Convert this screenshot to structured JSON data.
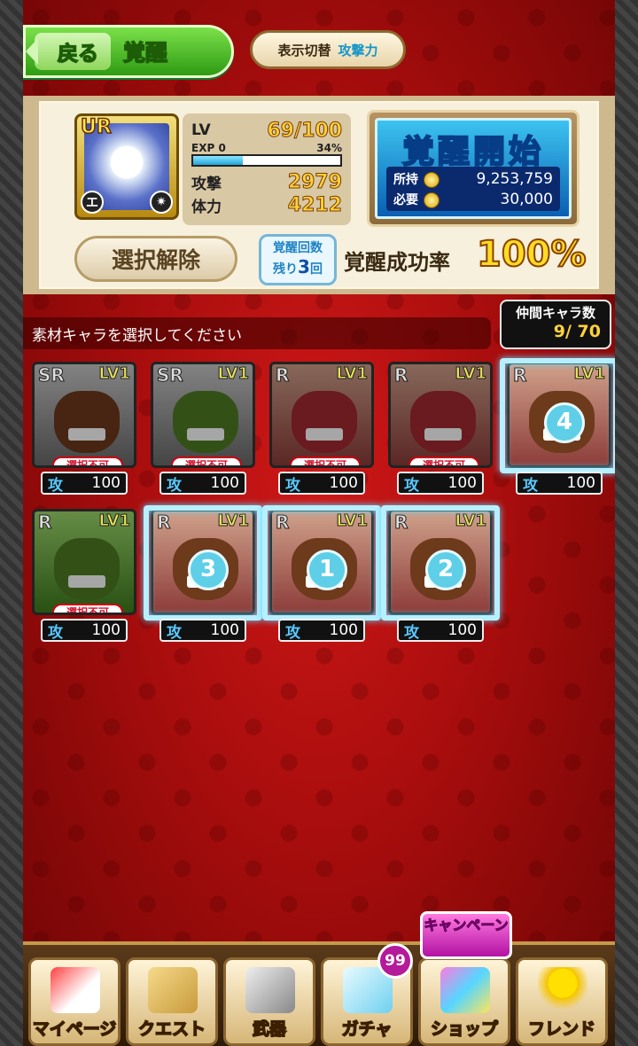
{
  "header": {
    "back_label": "戻る",
    "title": "覚醒",
    "toggle_label": "表示切替",
    "toggle_value": "攻撃力"
  },
  "character": {
    "rarity": "UR",
    "attr_left": "エ",
    "attr_right": "✷",
    "lv_label": "LV",
    "lv_value": "69/100",
    "exp_label": "EXP",
    "exp_value": "0",
    "exp_percent": "34%",
    "atk_label": "攻撃",
    "atk_value": "2979",
    "hp_label": "体力",
    "hp_value": "4212"
  },
  "awaken": {
    "title": "覚醒開始",
    "owned_label": "所持",
    "owned_value": "9,253,759",
    "required_label": "必要",
    "required_value": "30,000"
  },
  "release_label": "選択解除",
  "count": {
    "line1": "覚醒回数",
    "prefix": "残り",
    "value": "3",
    "suffix": "回"
  },
  "rate": {
    "label": "覚醒成功率",
    "value": "100%"
  },
  "notice": "素材キャラを選択してください",
  "party": {
    "label": "仲間キャラ数",
    "value": "9/ 70"
  },
  "cards": [
    {
      "rarity": "SR",
      "lv": "LV1",
      "ng": "選択不可",
      "atk_label": "攻",
      "atk": "100"
    },
    {
      "rarity": "SR",
      "lv": "LV1",
      "ng": "選択不可",
      "atk_label": "攻",
      "atk": "100"
    },
    {
      "rarity": "R",
      "lv": "LV1",
      "ng": "選択不可",
      "atk_label": "攻",
      "atk": "100"
    },
    {
      "rarity": "R",
      "lv": "LV1",
      "ng": "選択不可",
      "atk_label": "攻",
      "atk": "100"
    },
    {
      "rarity": "R",
      "lv": "LV1",
      "select": "4",
      "atk_label": "攻",
      "atk": "100"
    },
    {
      "rarity": "R",
      "lv": "LV1",
      "ng": "選択不可",
      "atk_label": "攻",
      "atk": "100"
    },
    {
      "rarity": "R",
      "lv": "LV1",
      "select": "3",
      "atk_label": "攻",
      "atk": "100"
    },
    {
      "rarity": "R",
      "lv": "LV1",
      "select": "1",
      "atk_label": "攻",
      "atk": "100"
    },
    {
      "rarity": "R",
      "lv": "LV1",
      "select": "2",
      "atk_label": "攻",
      "atk": "100"
    }
  ],
  "footer": {
    "items": [
      "マイページ",
      "クエスト",
      "武器",
      "ガチャ",
      "ショップ",
      "フレンド"
    ],
    "campaign_label": "キャンペーン",
    "gacha_badge": "99"
  }
}
